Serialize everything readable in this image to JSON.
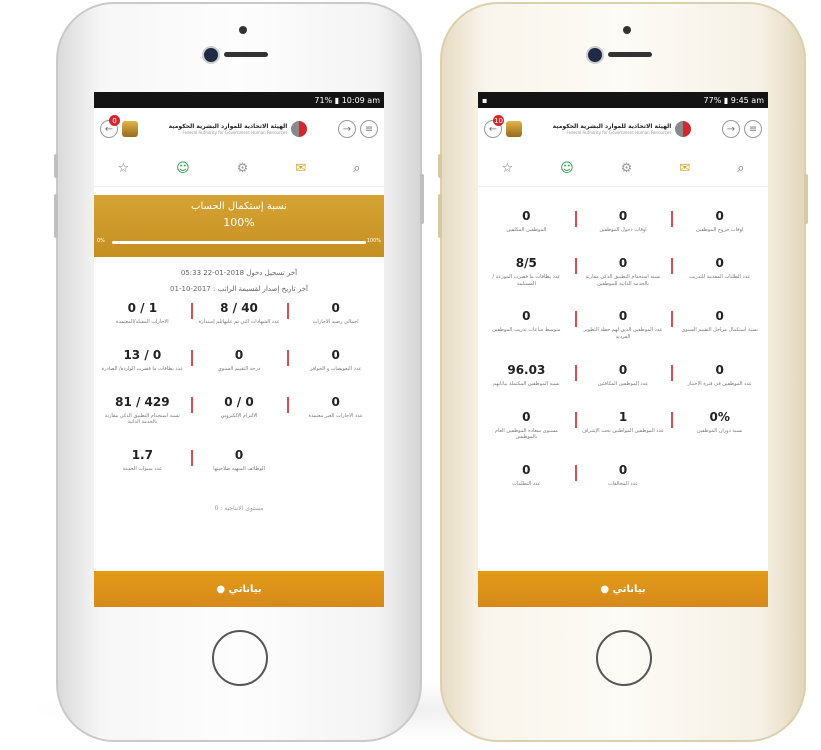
{
  "left_phone": {
    "status_time": "10:09 am",
    "status_battery": "71%",
    "badge": "0",
    "org_name": "الهيئة الاتحادية للموارد البشرية الحكومية",
    "org_sub": "Federal Authority for Government Human Resources",
    "progress_title": "نسبة إستكمال الحساب",
    "progress_value": "100%",
    "progress_fraction": 1.0,
    "progress_min": "0%",
    "progress_max": "100%",
    "last_login": "آخر تسجيل دخول 2018-01-22 05:33",
    "last_payslip": "آخر تاريخ إصدار لقسيمة الراتب : 2017-10-01",
    "stats": [
      {
        "value": "0",
        "label": "اجمالي رصيد الاجازات"
      },
      {
        "value": "8 / 40",
        "label": "عدد الشهادات التي تم عليهاثلم إستدارة"
      },
      {
        "value": "0 / 1",
        "label": "الاجازات المقبله/المعتمدة"
      },
      {
        "value": "0",
        "label": "عدد التعويضات و الحوافز"
      },
      {
        "value": "0",
        "label": "درجة التقييم السنوي"
      },
      {
        "value": "13 / 0",
        "label": "عدد بطاقات ما قصرت الواردة/ الصادرة"
      },
      {
        "value": "0",
        "label": "عدد الاجازات الغير معتمدة"
      },
      {
        "value": "0 / 0",
        "label": "الالتزام الالكتروني"
      },
      {
        "value": "81 / 429",
        "label": "نسبة استخدام التطبيق الذكي مقارنة بالخدمة الذاتية"
      },
      {
        "value": "",
        "label": ""
      },
      {
        "value": "0",
        "label": "الوظائف المتهية صلاحيتها"
      },
      {
        "value": "1.7",
        "label": "عدد سنوات الخدمة"
      }
    ],
    "bottom_text": "مستوى الانتاجية : 0",
    "footer_brand": "● بياناتي"
  },
  "right_phone": {
    "status_time": "9:45 am",
    "status_battery": "77%",
    "badge": "10",
    "org_name": "الهيئة الاتحادية للموارد البشرية الحكومية",
    "org_sub": "Federal Authority for Government Human Resources",
    "stats": [
      {
        "value": "0",
        "label": "اوقات خروج الموظفين"
      },
      {
        "value": "0",
        "label": "اوقات دخول الموظفين"
      },
      {
        "value": "0",
        "label": "الموظفين المكلفين"
      },
      {
        "value": "0",
        "label": "عدد الطلبات المقدمة للتدريب"
      },
      {
        "value": "0",
        "label": "نسبة استخدام التطبيق الذكي مقارنة بالخدمة الذاتية للموظفين"
      },
      {
        "value": "8/5",
        "label": "عدد بطاقات ما قصرت الموزعة / المستلمة"
      },
      {
        "value": "0",
        "label": "نسبة استكمال مراحل التقييم السنوي"
      },
      {
        "value": "0",
        "label": "عدد الموظفين الذين لهم خطة التطوير الفردية"
      },
      {
        "value": "0",
        "label": "متوسط ساعات تدريب الموظفين"
      },
      {
        "value": "0",
        "label": "عدد الموظفين في فترة الاختبار"
      },
      {
        "value": "0",
        "label": "عدد الموظفين المكافئين"
      },
      {
        "value": "96.03",
        "label": "نسبة الموظفين المكتملة بياناتهم"
      },
      {
        "value": "0%",
        "label": "نسبة دوران الموظفين"
      },
      {
        "value": "1",
        "label": "عدد الموظفين المواطنين تحت الإشراف"
      },
      {
        "value": "0",
        "label": "مستوى سعادة الموظفين العام بالموظفين"
      },
      {
        "value": "",
        "label": ""
      },
      {
        "value": "0",
        "label": "عدد المخالفات"
      },
      {
        "value": "0",
        "label": "عدد التظلمات"
      }
    ],
    "footer_brand": "● بياناتي"
  },
  "icons": {
    "star": "☆",
    "green": "☺",
    "gear": "⚙",
    "chat": "✉",
    "search": "⌕",
    "back": "←",
    "forward": "→",
    "menu": "≡"
  }
}
